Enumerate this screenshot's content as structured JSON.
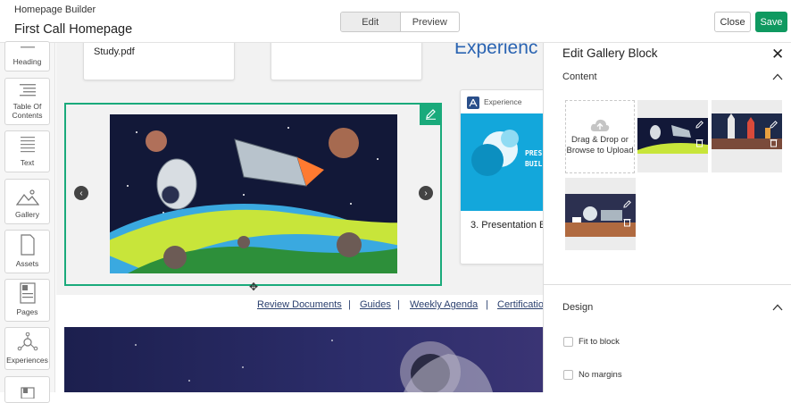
{
  "header": {
    "app_name": "Homepage Builder",
    "page_title": "First Call Homepage",
    "mode_tabs": [
      "Edit",
      "Preview"
    ],
    "close_label": "Close",
    "save_label": "Save"
  },
  "sidebar": {
    "tools": [
      "Heading",
      "Table Of Contents",
      "Text",
      "Gallery",
      "Assets",
      "Pages",
      "Experiences"
    ]
  },
  "canvas": {
    "pdf_card_text": "Study.pdf",
    "hero_heading": "Experienc",
    "experience_card": {
      "label": "Experience",
      "banner_text_1": "PRES",
      "banner_text_2": "BUIL",
      "title": "3. Presentation B"
    },
    "links": [
      "Review Documents",
      "Guides",
      "Weekly Agenda",
      "Certificatio"
    ],
    "link_separator": "|"
  },
  "panel": {
    "title": "Edit Gallery Block",
    "content_section": "Content",
    "upload_text": "Drag & Drop or Browse to Upload",
    "design_section": "Design",
    "options": [
      {
        "label": "Fit to block",
        "checked": false
      },
      {
        "label": "No margins",
        "checked": false
      }
    ]
  },
  "colors": {
    "accent_green": "#1aaa7b",
    "save_green": "#0f9960",
    "link_blue": "#2a3f6e",
    "heading_blue": "#2a64b2"
  }
}
